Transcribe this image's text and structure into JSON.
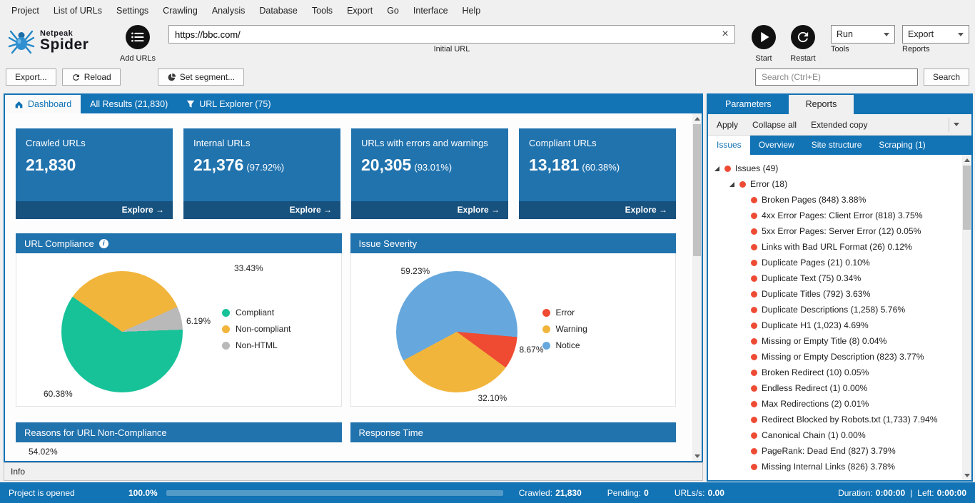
{
  "menu": {
    "items": [
      "Project",
      "List of URLs",
      "Settings",
      "Crawling",
      "Analysis",
      "Database",
      "Tools",
      "Export",
      "Go",
      "Interface",
      "Help"
    ]
  },
  "toolbar": {
    "brand_line1": "Netpeak",
    "brand_line2": "Spider",
    "add_urls_label": "Add URLs",
    "initial_url_value": "https://bbc.com/",
    "initial_url_label": "Initial URL",
    "start_label": "Start",
    "restart_label": "Restart",
    "run_value": "Run",
    "run_label": "Tools",
    "export_value": "Export",
    "export_label": "Reports"
  },
  "actionbar": {
    "export_button": "Export...",
    "reload_button": "Reload",
    "segment_button": "Set segment...",
    "search_placeholder": "Search (Ctrl+E)",
    "search_button": "Search"
  },
  "tabs": {
    "dashboard": "Dashboard",
    "all_results": "All Results (21,830)",
    "url_explorer": "URL Explorer (75)"
  },
  "kpi_cards": [
    {
      "title": "Crawled URLs",
      "value": "21,830",
      "percent": "",
      "action": "Explore →"
    },
    {
      "title": "Internal URLs",
      "value": "21,376",
      "percent": "(97.92%)",
      "action": "Explore →"
    },
    {
      "title": "URLs with errors and warnings",
      "value": "20,305",
      "percent": "(93.01%)",
      "action": "Explore →"
    },
    {
      "title": "Compliant URLs",
      "value": "13,181",
      "percent": "(60.38%)",
      "action": "Explore →"
    }
  ],
  "chart_data": [
    {
      "type": "pie",
      "title": "URL Compliance",
      "start_angle_deg": 88,
      "legend_position": "right",
      "slices": [
        {
          "label": "Compliant",
          "value": 60.38,
          "percent": "60.38%",
          "color": "#17c299"
        },
        {
          "label": "Non-compliant",
          "value": 33.43,
          "percent": "33.43%",
          "color": "#f2b53c"
        },
        {
          "label": "Non-HTML",
          "value": 6.19,
          "percent": "6.19%",
          "color": "#b9b9b9"
        }
      ]
    },
    {
      "type": "pie",
      "title": "Issue Severity",
      "start_angle_deg": 95,
      "legend_position": "right",
      "slices": [
        {
          "label": "Error",
          "value": 8.67,
          "percent": "8.67%",
          "color": "#ef4b33"
        },
        {
          "label": "Warning",
          "value": 32.1,
          "percent": "32.10%",
          "color": "#f2b53c"
        },
        {
          "label": "Notice",
          "value": 59.23,
          "percent": "59.23%",
          "color": "#66a8dd"
        }
      ]
    }
  ],
  "partial_charts": {
    "left_title": "Reasons for URL Non-Compliance",
    "left_partial_value": "54.02%",
    "right_title": "Response Time"
  },
  "right_panel": {
    "top_tabs": {
      "parameters": "Parameters",
      "reports": "Reports"
    },
    "actions": {
      "apply": "Apply",
      "collapse_all": "Collapse all",
      "extended_copy": "Extended copy"
    },
    "report_tabs": {
      "issues": "Issues",
      "overview": "Overview",
      "site_structure": "Site structure",
      "scraping": "Scraping (1)"
    },
    "dot_color": "#ee4b35",
    "tree": [
      {
        "label": "Issues (49)",
        "level": 0
      },
      {
        "label": "Error (18)",
        "level": 1
      },
      {
        "label": "Broken Pages (848) 3.88%",
        "level": 2
      },
      {
        "label": "4xx Error Pages: Client Error (818) 3.75%",
        "level": 2
      },
      {
        "label": "5xx Error Pages: Server Error (12) 0.05%",
        "level": 2
      },
      {
        "label": "Links with Bad URL Format (26) 0.12%",
        "level": 2
      },
      {
        "label": "Duplicate Pages (21) 0.10%",
        "level": 2
      },
      {
        "label": "Duplicate Text (75) 0.34%",
        "level": 2
      },
      {
        "label": "Duplicate Titles (792) 3.63%",
        "level": 2
      },
      {
        "label": "Duplicate Descriptions (1,258) 5.76%",
        "level": 2
      },
      {
        "label": "Duplicate H1 (1,023) 4.69%",
        "level": 2
      },
      {
        "label": "Missing or Empty Title (8) 0.04%",
        "level": 2
      },
      {
        "label": "Missing or Empty Description (823) 3.77%",
        "level": 2
      },
      {
        "label": "Broken Redirect (10) 0.05%",
        "level": 2
      },
      {
        "label": "Endless Redirect (1) 0.00%",
        "level": 2
      },
      {
        "label": "Max Redirections (2) 0.01%",
        "level": 2
      },
      {
        "label": "Redirect Blocked by Robots.txt (1,733) 7.94%",
        "level": 2
      },
      {
        "label": "Canonical Chain (1) 0.00%",
        "level": 2
      },
      {
        "label": "PageRank: Dead End (827) 3.79%",
        "level": 2
      },
      {
        "label": "Missing Internal Links (826) 3.78%",
        "level": 2
      }
    ]
  },
  "info_panel": {
    "title": "Info"
  },
  "status_bar": {
    "status": "Project is opened",
    "progress": "100.0%",
    "crawled_label": "Crawled:",
    "crawled_value": "21,830",
    "pending_label": "Pending:",
    "pending_value": "0",
    "urls_label": "URLs/s:",
    "urls_value": "0.00",
    "duration_label": "Duration:",
    "duration_value": "0:00:00",
    "separator": "|",
    "left_label": "Left:",
    "left_value": "0:00:00"
  }
}
